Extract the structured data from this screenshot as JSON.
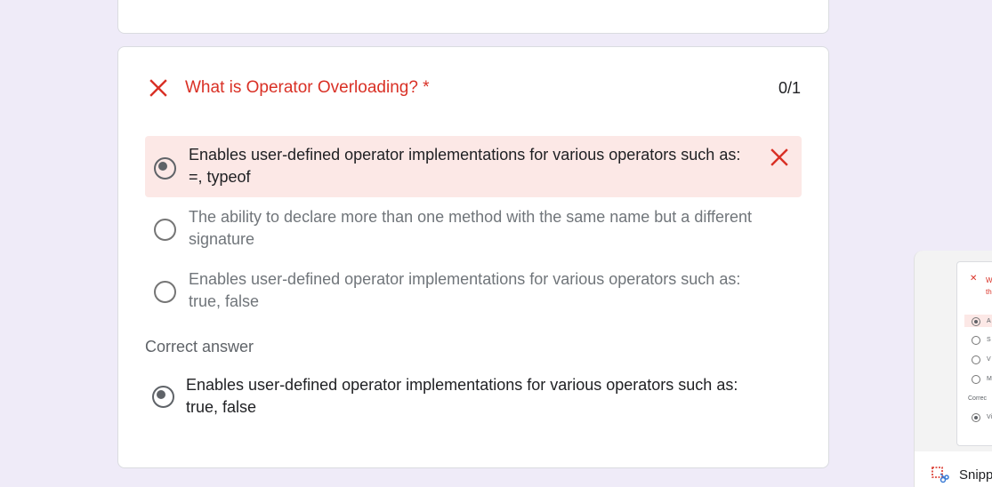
{
  "question": {
    "title": "What is Operator Overloading? *",
    "score": "0/1",
    "options": [
      {
        "text": "Enables user-defined operator implementations for various operators such as: =, typeof",
        "selected": true,
        "incorrect": true
      },
      {
        "text": "The ability to declare more than one method with the same name but a different signature",
        "selected": false
      },
      {
        "text": "Enables user-defined operator implementations for various operators such as: true, false",
        "selected": false
      }
    ],
    "correct_label": "Correct answer",
    "correct_answer": "Enables user-defined operator implementations for various operators such as: true, false"
  },
  "thumbnail": {
    "question_fragment": "W",
    "question_fragment_2": "th",
    "option_initials": [
      "A",
      "S",
      "V",
      "M"
    ],
    "correct_fragment": "Correc",
    "correct_initial": "Vi"
  },
  "taskbar": {
    "snip_label": "Snipp"
  },
  "colors": {
    "error_red": "#d93025",
    "wrong_bg": "#fce8e6",
    "page_bg": "#efebf8"
  },
  "icons": {
    "wrong_mark": "close-x-icon",
    "radio": "radio-icon",
    "snip": "snipping-tool-icon"
  }
}
